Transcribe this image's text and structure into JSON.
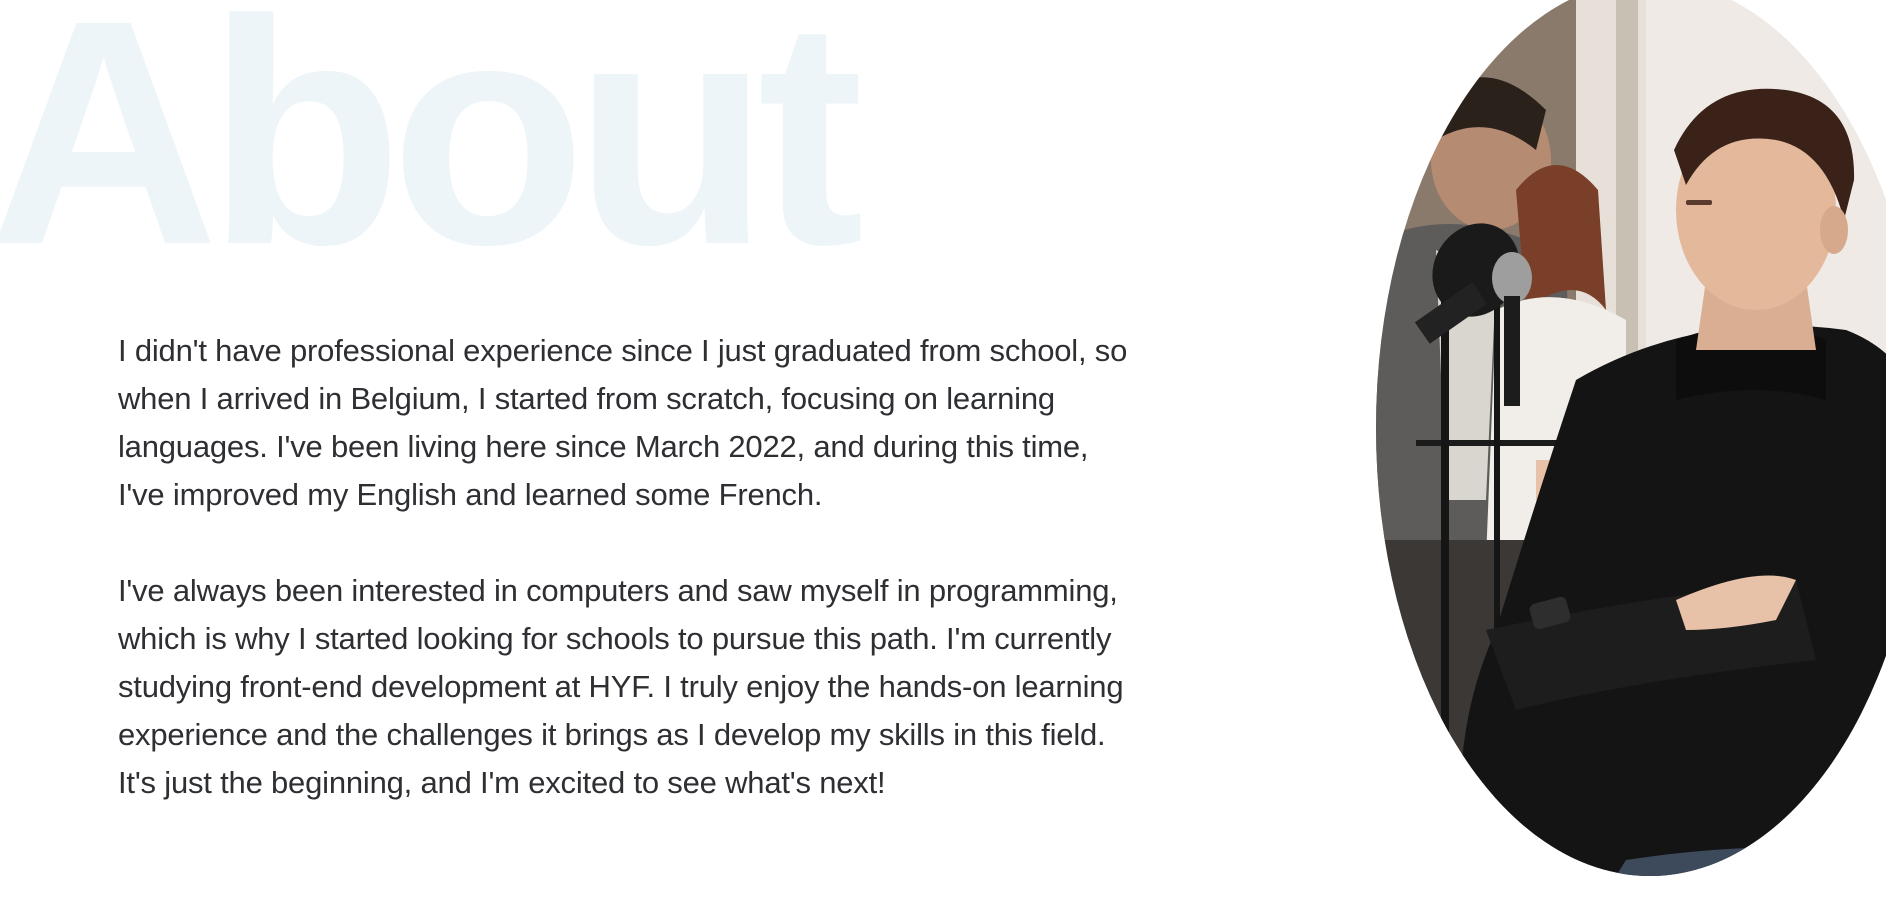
{
  "about": {
    "heading": "About",
    "paragraphs": [
      "I didn't have professional experience since I just graduated from school, so when I arrived in Belgium, I started from scratch, focusing on learning languages. I've been living here since March 2022, and during this time, I've improved my English and learned some French.",
      "I've always been interested in computers and saw myself in programming, which is why I started looking for schools to pursue this path. I'm currently studying front-end development at HYF. I truly enjoy the hands-on learning experience and the challenges it brings as I develop my skills in this field. It's just the beginning, and I'm excited to see what's next!"
    ]
  },
  "colors": {
    "background": "#ffffff",
    "watermark": "#edf5f9",
    "text": "#2d2f33"
  }
}
